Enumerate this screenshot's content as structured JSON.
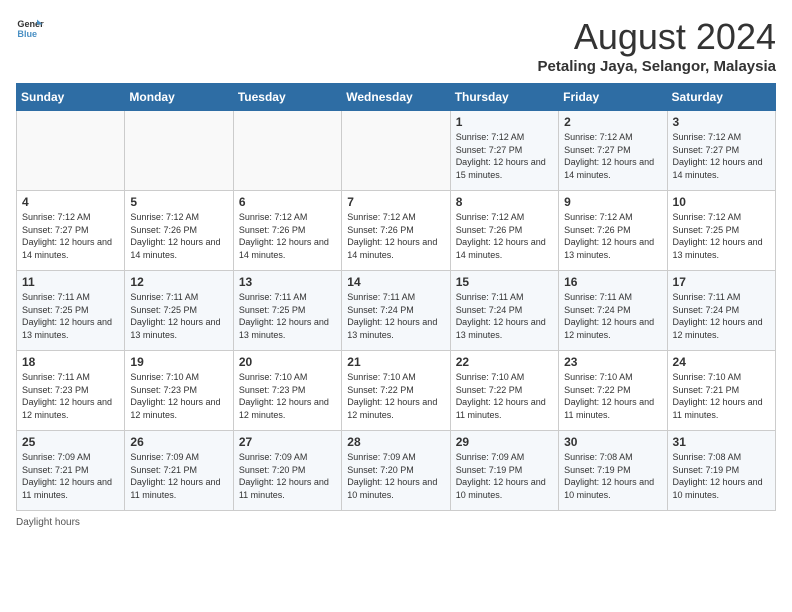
{
  "header": {
    "logo_line1": "General",
    "logo_line2": "Blue",
    "title": "August 2024",
    "subtitle": "Petaling Jaya, Selangor, Malaysia"
  },
  "days_of_week": [
    "Sunday",
    "Monday",
    "Tuesday",
    "Wednesday",
    "Thursday",
    "Friday",
    "Saturday"
  ],
  "weeks": [
    [
      {
        "day": "",
        "info": ""
      },
      {
        "day": "",
        "info": ""
      },
      {
        "day": "",
        "info": ""
      },
      {
        "day": "",
        "info": ""
      },
      {
        "day": "1",
        "info": "Sunrise: 7:12 AM\nSunset: 7:27 PM\nDaylight: 12 hours\nand 15 minutes."
      },
      {
        "day": "2",
        "info": "Sunrise: 7:12 AM\nSunset: 7:27 PM\nDaylight: 12 hours\nand 14 minutes."
      },
      {
        "day": "3",
        "info": "Sunrise: 7:12 AM\nSunset: 7:27 PM\nDaylight: 12 hours\nand 14 minutes."
      }
    ],
    [
      {
        "day": "4",
        "info": "Sunrise: 7:12 AM\nSunset: 7:27 PM\nDaylight: 12 hours\nand 14 minutes."
      },
      {
        "day": "5",
        "info": "Sunrise: 7:12 AM\nSunset: 7:26 PM\nDaylight: 12 hours\nand 14 minutes."
      },
      {
        "day": "6",
        "info": "Sunrise: 7:12 AM\nSunset: 7:26 PM\nDaylight: 12 hours\nand 14 minutes."
      },
      {
        "day": "7",
        "info": "Sunrise: 7:12 AM\nSunset: 7:26 PM\nDaylight: 12 hours\nand 14 minutes."
      },
      {
        "day": "8",
        "info": "Sunrise: 7:12 AM\nSunset: 7:26 PM\nDaylight: 12 hours\nand 14 minutes."
      },
      {
        "day": "9",
        "info": "Sunrise: 7:12 AM\nSunset: 7:26 PM\nDaylight: 12 hours\nand 13 minutes."
      },
      {
        "day": "10",
        "info": "Sunrise: 7:12 AM\nSunset: 7:25 PM\nDaylight: 12 hours\nand 13 minutes."
      }
    ],
    [
      {
        "day": "11",
        "info": "Sunrise: 7:11 AM\nSunset: 7:25 PM\nDaylight: 12 hours\nand 13 minutes."
      },
      {
        "day": "12",
        "info": "Sunrise: 7:11 AM\nSunset: 7:25 PM\nDaylight: 12 hours\nand 13 minutes."
      },
      {
        "day": "13",
        "info": "Sunrise: 7:11 AM\nSunset: 7:25 PM\nDaylight: 12 hours\nand 13 minutes."
      },
      {
        "day": "14",
        "info": "Sunrise: 7:11 AM\nSunset: 7:24 PM\nDaylight: 12 hours\nand 13 minutes."
      },
      {
        "day": "15",
        "info": "Sunrise: 7:11 AM\nSunset: 7:24 PM\nDaylight: 12 hours\nand 13 minutes."
      },
      {
        "day": "16",
        "info": "Sunrise: 7:11 AM\nSunset: 7:24 PM\nDaylight: 12 hours\nand 12 minutes."
      },
      {
        "day": "17",
        "info": "Sunrise: 7:11 AM\nSunset: 7:24 PM\nDaylight: 12 hours\nand 12 minutes."
      }
    ],
    [
      {
        "day": "18",
        "info": "Sunrise: 7:11 AM\nSunset: 7:23 PM\nDaylight: 12 hours\nand 12 minutes."
      },
      {
        "day": "19",
        "info": "Sunrise: 7:10 AM\nSunset: 7:23 PM\nDaylight: 12 hours\nand 12 minutes."
      },
      {
        "day": "20",
        "info": "Sunrise: 7:10 AM\nSunset: 7:23 PM\nDaylight: 12 hours\nand 12 minutes."
      },
      {
        "day": "21",
        "info": "Sunrise: 7:10 AM\nSunset: 7:22 PM\nDaylight: 12 hours\nand 12 minutes."
      },
      {
        "day": "22",
        "info": "Sunrise: 7:10 AM\nSunset: 7:22 PM\nDaylight: 12 hours\nand 11 minutes."
      },
      {
        "day": "23",
        "info": "Sunrise: 7:10 AM\nSunset: 7:22 PM\nDaylight: 12 hours\nand 11 minutes."
      },
      {
        "day": "24",
        "info": "Sunrise: 7:10 AM\nSunset: 7:21 PM\nDaylight: 12 hours\nand 11 minutes."
      }
    ],
    [
      {
        "day": "25",
        "info": "Sunrise: 7:09 AM\nSunset: 7:21 PM\nDaylight: 12 hours\nand 11 minutes."
      },
      {
        "day": "26",
        "info": "Sunrise: 7:09 AM\nSunset: 7:21 PM\nDaylight: 12 hours\nand 11 minutes."
      },
      {
        "day": "27",
        "info": "Sunrise: 7:09 AM\nSunset: 7:20 PM\nDaylight: 12 hours\nand 11 minutes."
      },
      {
        "day": "28",
        "info": "Sunrise: 7:09 AM\nSunset: 7:20 PM\nDaylight: 12 hours\nand 10 minutes."
      },
      {
        "day": "29",
        "info": "Sunrise: 7:09 AM\nSunset: 7:19 PM\nDaylight: 12 hours\nand 10 minutes."
      },
      {
        "day": "30",
        "info": "Sunrise: 7:08 AM\nSunset: 7:19 PM\nDaylight: 12 hours\nand 10 minutes."
      },
      {
        "day": "31",
        "info": "Sunrise: 7:08 AM\nSunset: 7:19 PM\nDaylight: 12 hours\nand 10 minutes."
      }
    ]
  ],
  "footer": {
    "note": "Daylight hours"
  }
}
